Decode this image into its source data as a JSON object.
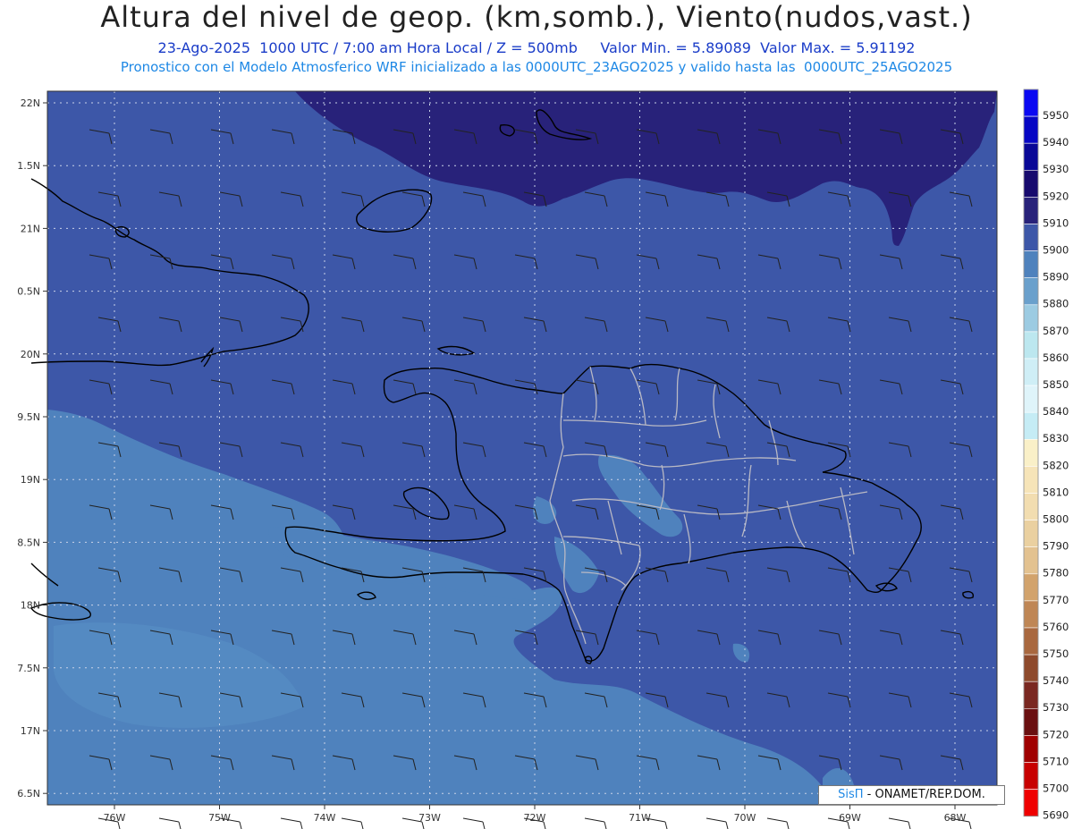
{
  "header": {
    "title": "Altura del nivel de geop. (km,somb.), Viento(nudos,vast.)",
    "subtitle_date_time": "23-Ago-2025  1000 UTC / 7:00 am Hora Local / Z = 500mb",
    "subtitle_min_max": "Valor Min. = 5.89089  Valor Max. = 5.91192",
    "model_info": "Pronostico con el Modelo Atmosferico WRF inicializado a las 0000UTC_23AGO2025 y valido hasta las  0000UTC_25AGO2025"
  },
  "map": {
    "lat_labels": [
      "22N",
      "1.5N",
      "21N",
      "0.5N",
      "20N",
      "9.5N",
      "19N",
      "8.5N",
      "18N",
      "7.5N",
      "17N",
      "6.5N"
    ],
    "lon_labels": [
      "76W",
      "75W",
      "74W",
      "73W",
      "72W",
      "71W",
      "70W",
      "69W",
      "68W"
    ],
    "colors": {
      "level_5900": "#3d57a8",
      "level_5910": "#28227a",
      "level_5890": "#4f82bd",
      "level_5880": "#6aa0cc",
      "coastline": "#000000",
      "provinces": "#b9b9c4"
    }
  },
  "colorbar": {
    "levels": [
      "5950",
      "5940",
      "5930",
      "5920",
      "5910",
      "5900",
      "5890",
      "5880",
      "5870",
      "5860",
      "5850",
      "5840",
      "5830",
      "5820",
      "5810",
      "5800",
      "5790",
      "5780",
      "5770",
      "5760",
      "5750",
      "5740",
      "5730",
      "5720",
      "5710",
      "5700",
      "5690"
    ],
    "colors": [
      "#0a08f2",
      "#0606c4",
      "#090897",
      "#170a6e",
      "#28227a",
      "#3d57a8",
      "#4f82bd",
      "#6aa0cc",
      "#9ccbe2",
      "#bce7ef",
      "#cfeef6",
      "#dff4fa",
      "#c5ecf5",
      "#faf0c8",
      "#f6e4b8",
      "#f2ddb0",
      "#ead0a0",
      "#e3c290",
      "#d2a36c",
      "#bf8655",
      "#a9683f",
      "#8e4a2c",
      "#7a2821",
      "#6a0f10",
      "#a00000",
      "#c80000",
      "#ef0000"
    ]
  },
  "credit": {
    "logo": "SisΠ",
    "text": " - ONAMET/REP.DOM."
  }
}
